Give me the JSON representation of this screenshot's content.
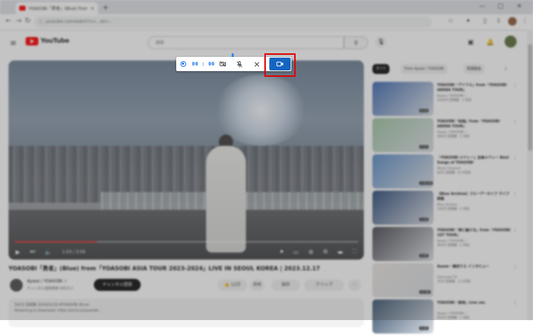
{
  "browser": {
    "tab_title": "YOASOBI「勇者」(Blue) from「Y...",
    "tab_close": "×",
    "new_tab": "+",
    "url": "youtube.com/watch?v=...&t=...",
    "window": {
      "minimize": "—",
      "maximize": "▢",
      "close": "×"
    }
  },
  "youtube": {
    "logo_text": "YouTube",
    "search_placeholder": "検索",
    "video": {
      "time": "1:03 / 3:59",
      "progress": 0.24
    },
    "title": "YOASOBI「勇者」(Blue) from「YOASOBI ASIA TOUR 2023-2024」LIVE IN SEOUL KOREA | 2023.12.17",
    "channel": {
      "name": "Ayase / YOASOBI ✓",
      "subs": "チャンネル登録者数 800万人"
    },
    "subscribe_label": "チャンネル登録",
    "actions": [
      "👍 12万",
      "共有",
      "保存",
      "クリップ"
    ],
    "description": {
      "line1": "392万 回視聴  2024/01/18  #YOASOBI #Live",
      "line2": "Streaming & Download: https://orcd.co/yoasobi..."
    },
    "chips": [
      "すべて",
      "From Ayase / YOASOBI",
      "関連動画"
    ],
    "recommendations": [
      {
        "title": "YOASOBI「アイドル」from「YOASOBI ARENA TOUR」",
        "channel": "Ayase / YOASOBI ✓",
        "meta": "1200万 回視聴 · 1 年前",
        "duration": "4:14",
        "color": "#3f6bb1"
      },
      {
        "title": "YOASOBI「祝福」from「YOASOBI ARENA TOUR」",
        "channel": "Ayase / YOASOBI ✓",
        "meta": "480万 回視聴 · 1 年前",
        "duration": "3:21",
        "color": "#9fc4a4"
      },
      {
        "title": "「YOASOBI メドレー」全曲メドレー Best Songs of YOASOBI",
        "channel": "Music Channel",
        "meta": "80万 回視聴 · 6 か月前",
        "duration": "1:02:44",
        "color": "#5a8bc5"
      },
      {
        "title": "【Blue Archive】ブルーアーカイブ ライブ映像",
        "channel": "Blue Archive",
        "meta": "150万 回視聴 · 2 年前",
        "duration": "5:10",
        "color": "#2d4a7a"
      },
      {
        "title": "YOASOBI「夜に駆ける」from「YOASOBI 1ST TOUR」",
        "channel": "Ayase / YOASOBI ✓",
        "meta": "900万 回視聴 · 2 年前",
        "duration": "4:40",
        "color": "#4a4a52"
      },
      {
        "title": "Ayase・幾田りら インタビュー",
        "channel": "Interview TV",
        "meta": "35万 回視聴 · 3 か月前",
        "duration": "12:08",
        "color": "#e9e4de"
      },
      {
        "title": "YOASOBI「群青」Live ver.",
        "channel": "Ayase / YOASOBI ✓",
        "meta": "600万 回視聴 · 1 年前",
        "duration": "4:20",
        "color": "#3c5670"
      }
    ]
  },
  "capture_toolbar": {
    "timer": "00 : 00",
    "icons": [
      "record-indicator-icon",
      "camera-off-icon",
      "mic-off-icon",
      "close-icon",
      "video-camera-icon"
    ],
    "accent": "#1565c0",
    "highlight": "#e00000"
  }
}
